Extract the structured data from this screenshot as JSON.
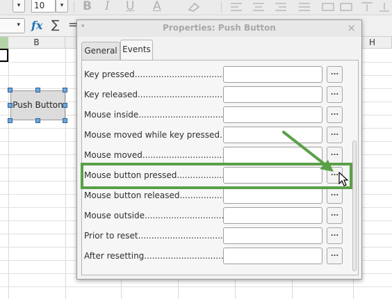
{
  "toolbar": {
    "font_size": "10",
    "glyph_bold": "B",
    "glyph_italic": "I",
    "glyph_underline": "U",
    "glyph_fontcolor": "A",
    "drop_arrow": "▾"
  },
  "formula_bar": {
    "fx_label": "fx",
    "sum_label": "∑",
    "eq_label": "="
  },
  "sheet": {
    "column_b": "B",
    "column_h": "H",
    "push_button_label": "Push Button"
  },
  "dialog": {
    "title": "Properties: Push Button",
    "close_glyph": "×",
    "menu_glyph": "▾",
    "tabs": [
      {
        "label": "General"
      },
      {
        "label": "Events"
      }
    ],
    "events": [
      {
        "label": "Key pressed......................................",
        "button": "..."
      },
      {
        "label": "Key released....................................",
        "button": "..."
      },
      {
        "label": "Mouse inside....................................",
        "button": "..."
      },
      {
        "label": "Mouse moved while key pressed.....",
        "button": "..."
      },
      {
        "label": "Mouse moved.....................................",
        "button": "..."
      },
      {
        "label": "Mouse button pressed.......................",
        "button": "..."
      },
      {
        "label": "Mouse button released.....................",
        "button": "..."
      },
      {
        "label": "Mouse outside...................................",
        "button": "..."
      },
      {
        "label": "Prior to reset.....................................",
        "button": "..."
      },
      {
        "label": "After resetting....................................",
        "button": "..."
      }
    ]
  },
  "colors": {
    "highlight": "#5aa047",
    "handle": "#6fa8dc",
    "fx": "#1f6fb5"
  }
}
